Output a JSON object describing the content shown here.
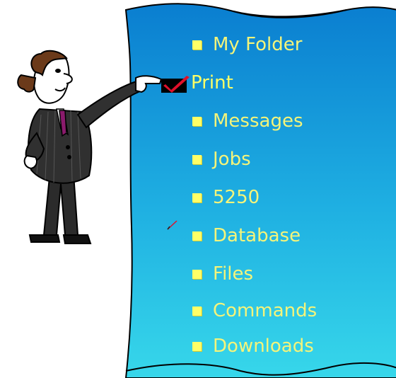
{
  "menu": {
    "items": [
      {
        "label": "My Folder",
        "selected": false
      },
      {
        "label": "Print",
        "selected": true
      },
      {
        "label": "Messages",
        "selected": false
      },
      {
        "label": "Jobs",
        "selected": false
      },
      {
        "label": "5250",
        "selected": false
      },
      {
        "label": "Database",
        "selected": false
      },
      {
        "label": "Files",
        "selected": false
      },
      {
        "label": "Commands",
        "selected": false
      },
      {
        "label": "Downloads",
        "selected": false
      }
    ]
  },
  "colors": {
    "panel_top": "#0a7ed0",
    "panel_bottom": "#37d7ea",
    "bullet": "#ffff66",
    "label": "#f4f47a",
    "check": "#e0102a",
    "suit": "#2b2b2b",
    "tie": "#8a1b6c"
  }
}
